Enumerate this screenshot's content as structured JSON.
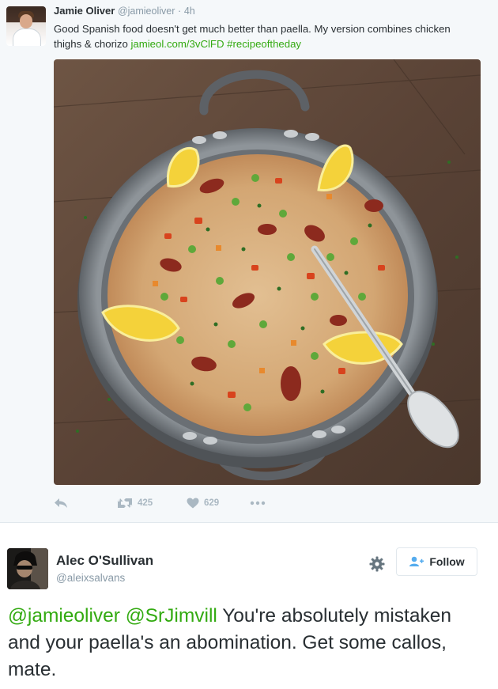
{
  "tweet1": {
    "author_name": "Jamie Oliver",
    "handle": "@jamieoliver",
    "separator": "·",
    "time": "4h",
    "text_before_link": "Good Spanish food doesn't get much better than paella. My version combines chicken thighs & chorizo ",
    "link": "jamieol.com/3vClFD",
    "hashtag": "#recipeoftheday",
    "retweet_count": "425",
    "like_count": "629",
    "icons": [
      "reply-icon",
      "retweet-icon",
      "heart-icon",
      "more-icon"
    ]
  },
  "tweet2": {
    "author_name": "Alec O'Sullivan",
    "handle": "@aleixsalvans",
    "follow_label": "Follow",
    "mention1": "@jamieoliver",
    "mention2": "@SrJimvill",
    "text": " You're absolutely mistaken and your paella's an abomination. Get some callos, mate.",
    "icons": [
      "gear-icon",
      "follow-person-icon"
    ]
  },
  "colors": {
    "hashtag_green": "#33aa11",
    "muted_gray": "#8899a6",
    "icon_gray": "#aab8c2",
    "text_dark": "#292f33"
  }
}
